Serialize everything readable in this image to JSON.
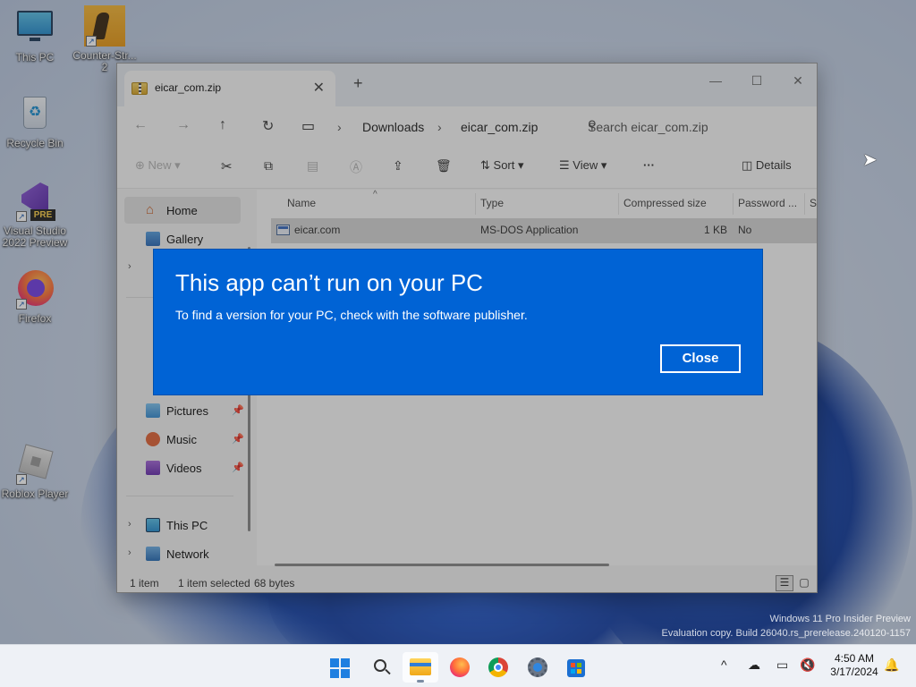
{
  "desktop": {
    "icons": [
      {
        "label": "This PC"
      },
      {
        "label": "Counter-Str...",
        "label2": "2"
      },
      {
        "label": "Recycle Bin"
      },
      {
        "label": "Visual Studio",
        "label2": "2022 Preview",
        "badge": "PRE"
      },
      {
        "label": "Firefox"
      },
      {
        "label": "Roblox Player"
      }
    ],
    "watermark_line1": "Windows 11 Pro Insider Preview",
    "watermark_line2": "Evaluation copy. Build 26040.rs_prerelease.240120-1157"
  },
  "explorer": {
    "tab_title": "eicar_com.zip",
    "new_tab": "+",
    "breadcrumbs": [
      "Downloads",
      "eicar_com.zip"
    ],
    "search_placeholder": "Search eicar_com.zip",
    "toolbar": {
      "new_label": "New",
      "sort_label": "Sort",
      "view_label": "View",
      "more_label": "···",
      "details_label": "Details"
    },
    "sidebar": {
      "home": "Home",
      "gallery": "Gallery",
      "pictures": "Pictures",
      "music": "Music",
      "videos": "Videos",
      "this_pc": "This PC",
      "network": "Network"
    },
    "columns": [
      "Name",
      "Type",
      "Compressed size",
      "Password ...",
      "Si"
    ],
    "rows": [
      {
        "name": "eicar.com",
        "type": "MS-DOS Application",
        "size": "1 KB",
        "password": "No"
      }
    ],
    "status": {
      "count": "1 item",
      "selected": "1 item selected",
      "bytes": "68 bytes"
    }
  },
  "dialog": {
    "title": "This app can’t run on your PC",
    "message": "To find a version for your PC, check with the software publisher.",
    "close_label": "Close",
    "color": "#0063d5"
  },
  "taskbar": {
    "apps": [
      "start-icon",
      "search-icon",
      "file-explorer-icon",
      "firefox-icon",
      "chrome-icon",
      "settings-icon",
      "store-icon"
    ],
    "time": "4:50 AM",
    "date": "3/17/2024"
  }
}
